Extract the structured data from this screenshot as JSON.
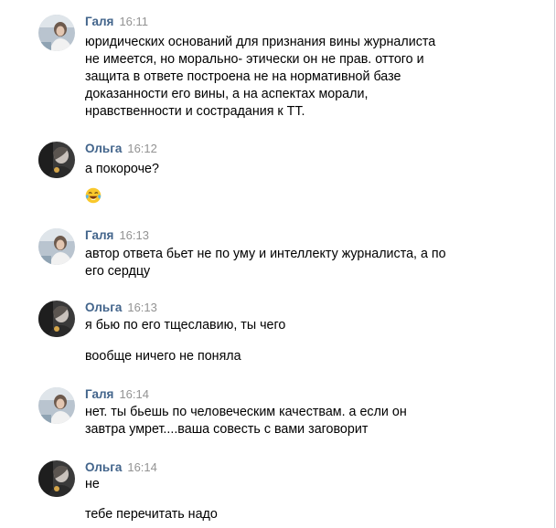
{
  "messages": [
    {
      "author": "Галя",
      "time": "16:11",
      "lines": [
        "юридических оснований для признания вины журналиста",
        "не имеется, но морально- этически он не прав. оттого и",
        "защита в ответе построена не на нормативной базе",
        "доказанности его вины, а на аспектах морали,",
        "нравственности и сострадания к ТТ."
      ]
    },
    {
      "author": "Ольга",
      "time": "16:12",
      "lines": [
        "а покороче?"
      ],
      "emoji": "face-with-tears-of-joy-emoji"
    },
    {
      "author": "Галя",
      "time": "16:13",
      "lines": [
        "автор ответа бьет не по уму и интеллекту журналиста, а по",
        "его сердцу"
      ]
    },
    {
      "author": "Ольга",
      "time": "16:13",
      "lines": [
        "я бью по его тщеславию, ты чего"
      ],
      "extra_lines": [
        "вообще ничего не поняла"
      ]
    },
    {
      "author": "Галя",
      "time": "16:14",
      "lines": [
        "нет. ты бьешь по человеческим качествам. а если он",
        "завтра умрет....ваша совесть с вами заговорит"
      ]
    },
    {
      "author": "Ольга",
      "time": "16:14",
      "lines": [
        "не"
      ],
      "extra_lines": [
        "тебе перечитать надо"
      ]
    }
  ],
  "colors": {
    "author": "#42648b",
    "time": "#939393",
    "text": "#000000",
    "background": "#ffffff"
  }
}
